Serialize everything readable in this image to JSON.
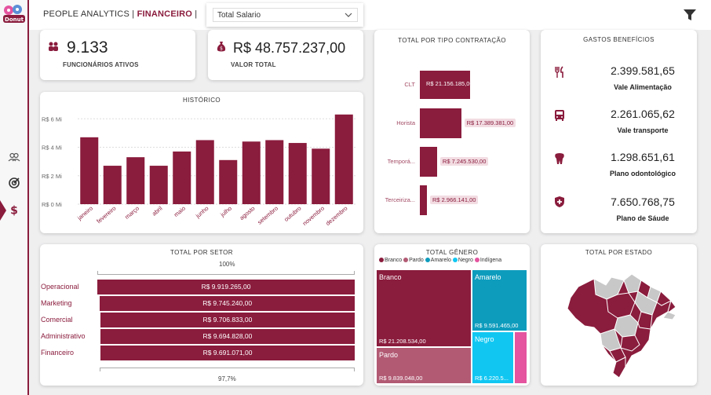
{
  "colors": {
    "accent": "#8a1c3d",
    "pardo": "#b25a74",
    "amarelo": "#0e9cbd",
    "negro": "#11c7f2",
    "indigena": "#e4549f",
    "map_gray": "#c8c8c8"
  },
  "header": {
    "title_prefix": "PEOPLE ANALYTICS |",
    "title_section": "FINANCEIRO",
    "title_suffix": "|",
    "dropdown_value": "Total Salario"
  },
  "sidebar": {
    "icons": [
      "people-icon",
      "target-icon",
      "dollar-icon"
    ]
  },
  "kpis": {
    "employees": {
      "value": "9.133",
      "label": "FUNCIONÁRIOS ATIVOS",
      "icon": "people-icon"
    },
    "total": {
      "value": "R$ 48.757.237,00",
      "label": "VALOR TOTAL",
      "icon": "money-bag-icon"
    }
  },
  "historico": {
    "title": "HISTÓRICO",
    "chart_data": {
      "type": "bar",
      "categories": [
        "janeiro",
        "fevereiro",
        "março",
        "abril",
        "maio",
        "junho",
        "julho",
        "agosto",
        "setembro",
        "outubro",
        "novembro",
        "dezembro"
      ],
      "values": [
        4.7,
        2.7,
        3.3,
        2.7,
        3.7,
        4.5,
        3.1,
        4.4,
        4.5,
        4.3,
        3.9,
        6.3
      ],
      "yticks": [
        "R$ 0 Mi",
        "R$ 2 Mi",
        "R$ 4 Mi",
        "R$ 6 Mi"
      ],
      "ylim": [
        0,
        6.4
      ],
      "grid": true
    }
  },
  "contratacao": {
    "title": "TOTAL POR TIPO CONTRATAÇÃO",
    "chart_data": {
      "type": "bar",
      "orientation": "horizontal",
      "categories": [
        "CLT",
        "Horista",
        "Temporá...",
        "Terceiriza..."
      ],
      "values": [
        21156185,
        17389381,
        7245530,
        2966141
      ],
      "labels": [
        "R$ 21.156.185,00",
        "R$ 17.389.381,00",
        "R$ 7.245.530,00",
        "R$ 2.966.141,00"
      ]
    }
  },
  "beneficios": {
    "title": "GASTOS BENEFÍCIOS",
    "items": [
      {
        "value": "2.399.581,65",
        "label": "Vale Alimentação",
        "icon": "fork-knife-icon"
      },
      {
        "value": "2.261.065,62",
        "label": "Vale transporte",
        "icon": "bus-icon"
      },
      {
        "value": "1.298.651,61",
        "label": "Plano odontológico",
        "icon": "tooth-icon"
      },
      {
        "value": "7.650.768,75",
        "label": "Plano de Sáude",
        "icon": "shield-plus-icon"
      }
    ]
  },
  "setor": {
    "title": "TOTAL POR SETOR",
    "top_pct": "100%",
    "bottom_pct": "97,7%",
    "chart_data": {
      "type": "bar",
      "orientation": "horizontal",
      "categories": [
        "Operacional",
        "Marketing",
        "Comercial",
        "Administrativo",
        "Financeiro"
      ],
      "values": [
        9919265,
        9745240,
        9706833,
        9694828,
        9691071
      ],
      "labels": [
        "R$ 9.919.265,00",
        "R$ 9.745.240,00",
        "R$ 9.706.833,00",
        "R$ 9.694.828,00",
        "R$ 9.691.071,00"
      ]
    }
  },
  "genero": {
    "title": "TOTAL GÊNERO",
    "legend": [
      "Branco",
      "Pardo",
      "Amarelo",
      "Negro",
      "Indígena"
    ],
    "tiles": [
      {
        "name": "Branco",
        "value": "R$ 21.208.534,00"
      },
      {
        "name": "Pardo",
        "value": "R$ 9.839.048,00"
      },
      {
        "name": "Amarelo",
        "value": "R$ 9.591.465,00"
      },
      {
        "name": "Negro",
        "value": "R$ 6.220.5..."
      },
      {
        "name": "",
        "value": ""
      }
    ]
  },
  "estado": {
    "title": "TOTAL POR ESTADO"
  }
}
